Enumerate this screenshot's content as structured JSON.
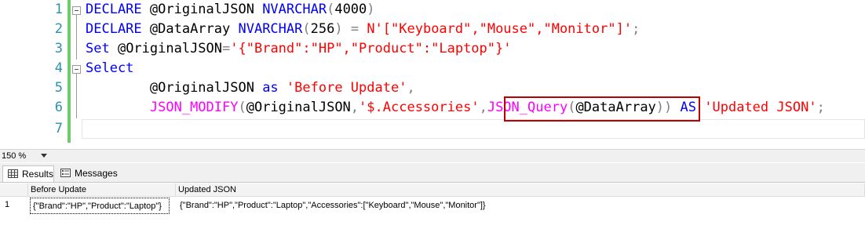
{
  "editor": {
    "line_numbers": [
      "1",
      "2",
      "3",
      "4",
      "5",
      "6",
      "7"
    ],
    "lines": {
      "l1": {
        "kw1": "DECLARE",
        "var": " @OriginalJSON ",
        "type": "NVARCHAR",
        "p1": "(",
        "num": "4000",
        "p2": ")"
      },
      "l2": {
        "kw1": "DECLARE",
        "var": " @DataArray ",
        "type": "NVARCHAR",
        "p1": "(",
        "num": "256",
        "p2": ")",
        "eq": " = ",
        "str": "N'[\"Keyboard\",\"Mouse\",\"Monitor\"]'",
        "semi": ";"
      },
      "l3": {
        "kw1": "Set",
        "var": " @OriginalJSON",
        "eq": "=",
        "str": "'{\"Brand\":\"HP\",\"Product\":\"Laptop\"}'"
      },
      "l4": {
        "kw1": "Select"
      },
      "l5": {
        "indent": "        ",
        "var": "@OriginalJSON ",
        "kw": "as",
        "sp": " ",
        "str": "'Before Update'",
        "comma": ","
      },
      "l6": {
        "indent": "        ",
        "fn": "JSON_MODIFY",
        "p1": "(",
        "var": "@OriginalJSON",
        "c1": ",",
        "str": "'$.Accessories'",
        "c2": ",",
        "fn2": "JSON_Query",
        "p2": "(",
        "var2": "@DataArray",
        "p3": "))",
        "sp": " ",
        "kw": "AS",
        "sp2": " ",
        "str2": "'Updated JSON'",
        "semi": ";"
      }
    }
  },
  "zoom": "150 %",
  "tabs": {
    "results": "Results",
    "messages": "Messages"
  },
  "grid": {
    "columns": [
      "Before Update",
      "Updated JSON"
    ],
    "rows": [
      {
        "num": "1",
        "before": "{\"Brand\":\"HP\",\"Product\":\"Laptop\"}",
        "updated": "{\"Brand\":\"HP\",\"Product\":\"Laptop\",\"Accessories\":[\"Keyboard\",\"Mouse\",\"Monitor\"]}"
      }
    ]
  },
  "colors": {
    "keyword": "#0000ff",
    "string": "#ff0000",
    "function": "#ff00ff",
    "operator": "#808080",
    "line_number": "#2b91af",
    "highlight_box": "#c00000"
  }
}
